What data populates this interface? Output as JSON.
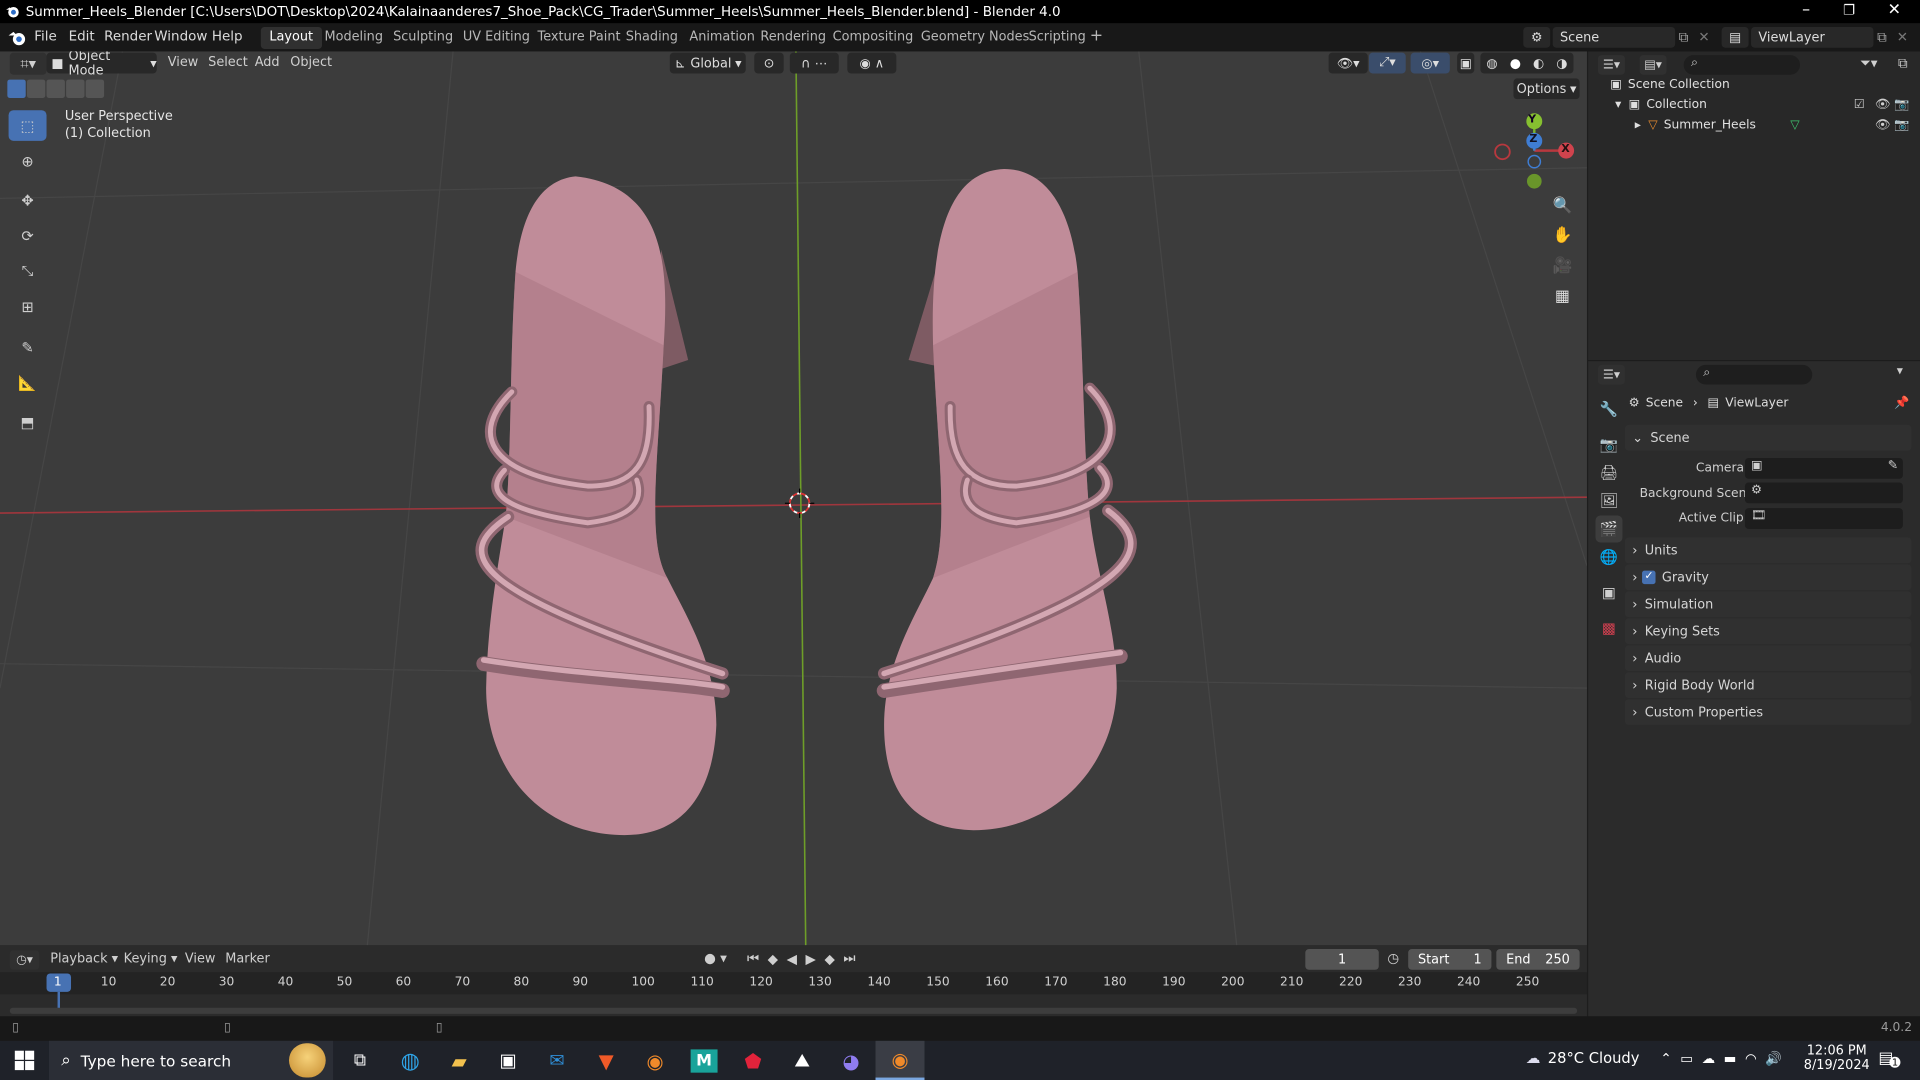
{
  "window": {
    "title": "Summer_Heels_Blender [C:\\Users\\DOT\\Desktop\\2024\\Kalainaanderes7_Shoe_Pack\\CG_Trader\\Summer_Heels\\Summer_Heels_Blender.blend] - Blender 4.0"
  },
  "menu": [
    "File",
    "Edit",
    "Render",
    "Window",
    "Help"
  ],
  "workspaces": [
    "Layout",
    "Modeling",
    "Sculpting",
    "UV Editing",
    "Texture Paint",
    "Shading",
    "Animation",
    "Rendering",
    "Compositing",
    "Geometry Nodes",
    "Scripting",
    "+"
  ],
  "scene": {
    "label": "Scene",
    "viewlayer": "ViewLayer"
  },
  "viewport": {
    "mode": "Object Mode",
    "view": "View",
    "select": "Select",
    "add": "Add",
    "object": "Object",
    "transform": "Global",
    "options": "Options",
    "overlay_line1": "User Perspective",
    "overlay_line2": "(1) Collection",
    "gizmo": {
      "y": "Y",
      "z": "Z",
      "x": "X"
    }
  },
  "outliner": {
    "scene_collection": "Scene Collection",
    "collection": "Collection",
    "object": "Summer_Heels"
  },
  "properties": {
    "breadcrumb": [
      "Scene",
      "ViewLayer"
    ],
    "panel_title": "Scene",
    "fields": [
      {
        "label": "Camera"
      },
      {
        "label": "Background Scene"
      },
      {
        "label": "Active Clip"
      }
    ],
    "sections": [
      "Units",
      "Gravity",
      "Simulation",
      "Keying Sets",
      "Audio",
      "Rigid Body World",
      "Custom Properties"
    ],
    "gravity_checked": true
  },
  "timeline": {
    "menus": [
      "Playback",
      "Keying",
      "View",
      "Marker"
    ],
    "current_frame": "1",
    "start_label": "Start",
    "start": "1",
    "end_label": "End",
    "end": "250",
    "ticks": [
      "1",
      "10",
      "20",
      "30",
      "40",
      "50",
      "60",
      "70",
      "80",
      "90",
      "100",
      "110",
      "120",
      "130",
      "140",
      "150",
      "160",
      "170",
      "180",
      "190",
      "200",
      "210",
      "220",
      "230",
      "240",
      "250"
    ]
  },
  "status": {
    "version": "4.0.2"
  },
  "taskbar": {
    "search_placeholder": "Type here to search",
    "weather": "28°C  Cloudy",
    "time": "12:06 PM",
    "date": "8/19/2024",
    "notif_count": "1"
  },
  "colors": {
    "accent": "#4772b3",
    "shoe": "#c28f9c",
    "axis_x": "#b8383e",
    "axis_y": "#7ab22c"
  }
}
